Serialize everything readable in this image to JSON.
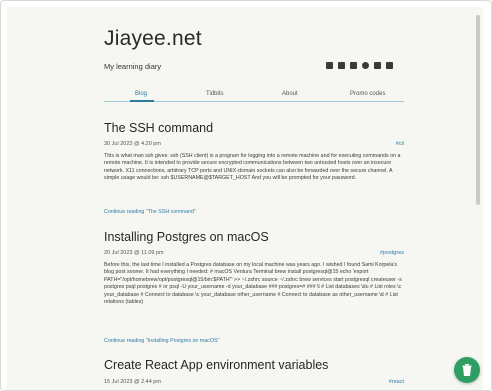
{
  "site": {
    "title": "Jiayee.net",
    "tagline": "My learning diary",
    "social_icons": [
      "mail-icon",
      "document-icon",
      "facebook-icon",
      "github-icon",
      "linkedin-icon",
      "stackoverflow-icon"
    ]
  },
  "nav": {
    "items": [
      {
        "label": "Blog",
        "active": true
      },
      {
        "label": "Tidbits",
        "active": false
      },
      {
        "label": "About",
        "active": false
      },
      {
        "label": "Promo codes",
        "active": false
      }
    ]
  },
  "posts": [
    {
      "title": "The SSH command",
      "date": "30 Jul 2023 @ 4.20 pm",
      "tag": "#cli",
      "body": "This is what man ssh gives: ssh (SSH client) is a program for logging into a remote machine and for executing commands on a remote machine. It is intended to provide secure encrypted communications between two untrusted hosts over an insecure network. X11 connections, arbitrary TCP ports and UNIX-domain sockets can also be forwarded over the secure channel. A simple usage would be: ssh $USERNAME@$TARGET_HOST And you will be prompted for your password.",
      "read_more": "Continue reading \"The SSH command\""
    },
    {
      "title": "Installing Postgres on macOS",
      "date": "20 Jul 2023 @ 11.09 pm",
      "tag": "#postgres",
      "body": "Before this, the last time I installed a Postgres database on my local machine was years ago. I wished I found Sami Korpela's blog post sooner. It had everything I needed: # macOS Ventura Terminal brew install postgresql@15 echo 'export PATH=\"/opt/homebrew/opt/postgresql@15/bin:$PATH\"' >> ~/.zshrc source ~/.zshrc brew services start postgresql createuser -s postgres psql postgres # or psql -U your_username -d your_database ### postgres=# ### \\l # List databases \\du # List roles \\c your_database # Connect to database \\c your_database other_username # Connect to database as other_username \\d # List relations (tables)",
      "read_more": "Continue reading \"Installing Postgres on macOS\""
    },
    {
      "title": "Create React App environment variables",
      "date": "15 Jul 2023 @ 2.44 pm",
      "tag": "#react"
    }
  ],
  "colors": {
    "accent": "#2e7da0",
    "fab": "#2f9e61",
    "page_bg": "#f6f6f3"
  },
  "fab": {
    "icon": "coffee-cup-icon"
  }
}
